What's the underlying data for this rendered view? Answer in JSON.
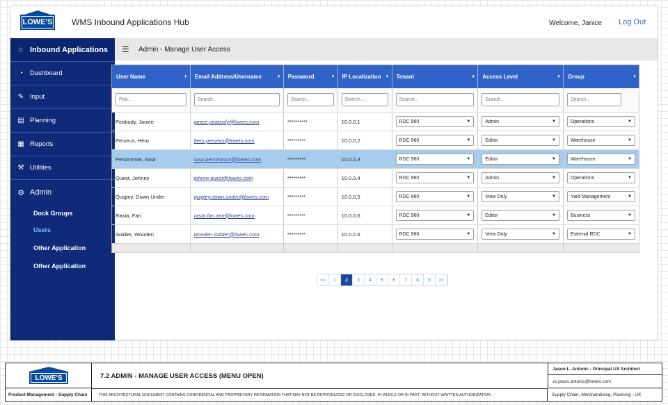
{
  "header": {
    "logo_text": "LOWE'S",
    "app_title": "WMS Inbound Applications Hub",
    "welcome": "Welcome, Janice",
    "logout": "Log Out"
  },
  "sidebar": {
    "heading": "Inbound Applications",
    "items": [
      {
        "label": "Dashboard",
        "icon": "dashboard-icon"
      },
      {
        "label": "Input",
        "icon": "edit-icon"
      },
      {
        "label": "Planning",
        "icon": "clipboard-icon"
      },
      {
        "label": "Reports",
        "icon": "document-icon"
      },
      {
        "label": "Utilities",
        "icon": "wrench-icon"
      }
    ],
    "admin_label": "Admin",
    "admin_sub": [
      "Dock Groups",
      "Users",
      "Other Application",
      "Other Application"
    ],
    "active_sub": "Users"
  },
  "page": {
    "title": "Admin - Manage User Access"
  },
  "table": {
    "columns": [
      "User Name",
      "Email Address/Username",
      "Password",
      "IP Localization",
      "Tenant",
      "Access Level",
      "Group"
    ],
    "filter_placeholders": [
      "Pea...",
      "Search...",
      "Search...",
      "Search...",
      "Search...",
      "Search...",
      "Search..."
    ],
    "rows": [
      {
        "name": "Peabody, Janice",
        "email": "janice.peabody@lowes.com",
        "password": "**********",
        "ip": "10.0.0.1",
        "tenant": "RDC 960",
        "access": "Admin",
        "group": "Operations"
      },
      {
        "name": "Perseus, Hero",
        "email": "hero.perseus@lowes.com",
        "password": "*********",
        "ip": "10.0.0.2",
        "tenant": "RDC 960",
        "access": "Editor",
        "group": "Warehouse"
      },
      {
        "name": "Persimmon, Sour",
        "email": "sour.persimmon@lowes.com",
        "password": "*********",
        "ip": "10.0.0.3",
        "tenant": "RDC 960",
        "access": "Editor",
        "group": "Warehouse",
        "selected": true
      },
      {
        "name": "Quest, Johnny",
        "email": "johnny.quest@lowes.com",
        "password": "*********",
        "ip": "10.0.0.4",
        "tenant": "RDC 960",
        "access": "Admin",
        "group": "Operations"
      },
      {
        "name": "Quigley, Down Under",
        "email": "quigley.down.under@lowes.com",
        "password": "*********",
        "ip": "10.0.0.5",
        "tenant": "RDC 960",
        "access": "View Only",
        "group": "Yard Management"
      },
      {
        "name": "Rasta, Fari",
        "email": "rasta.fari.ann@lowes.com",
        "password": "*********",
        "ip": "10.0.0.6",
        "tenant": "RDC 960",
        "access": "Editor",
        "group": "Business"
      },
      {
        "name": "Soldier, Wooden",
        "email": "wooden.soldier@lowes.com",
        "password": "*********",
        "ip": "10.0.0.6",
        "tenant": "RDC 960",
        "access": "View Only",
        "group": "External RDC"
      }
    ]
  },
  "pagination": {
    "first": "<<",
    "pages": [
      "1",
      "2",
      "3",
      "4",
      "5",
      "6",
      "7",
      "8",
      "9"
    ],
    "current": "2",
    "last": ">>"
  },
  "footer": {
    "logo_text": "LOWE'S",
    "title": "7.2  ADMIN - MANAGE USER ACCESS (MENU OPEN)",
    "dept_left": "Product Management - Supply Chain",
    "confidential": "THIS ARCHITECTURAL DOCUMENT CONTAINS CONFIDENTIAL AND PROPRIETARY INFORMATION THAT MAY NOT BE REPRODUCED OR DISCLOSED, IN WHOLE OR IN PART, WITHOUT WRITTEN AUTHORIZATION",
    "author": "Jason L. Antonic - Principal UX Architect",
    "email": "vc.jason.antonic@lowes.com",
    "dept_right": "Supply Chain, Merchandising, Planning - UX"
  },
  "colors": {
    "sidebar": "#0e2a78",
    "table_header": "#2f63c7",
    "selected_row": "#a7cdee",
    "link": "#2f6fd1"
  }
}
